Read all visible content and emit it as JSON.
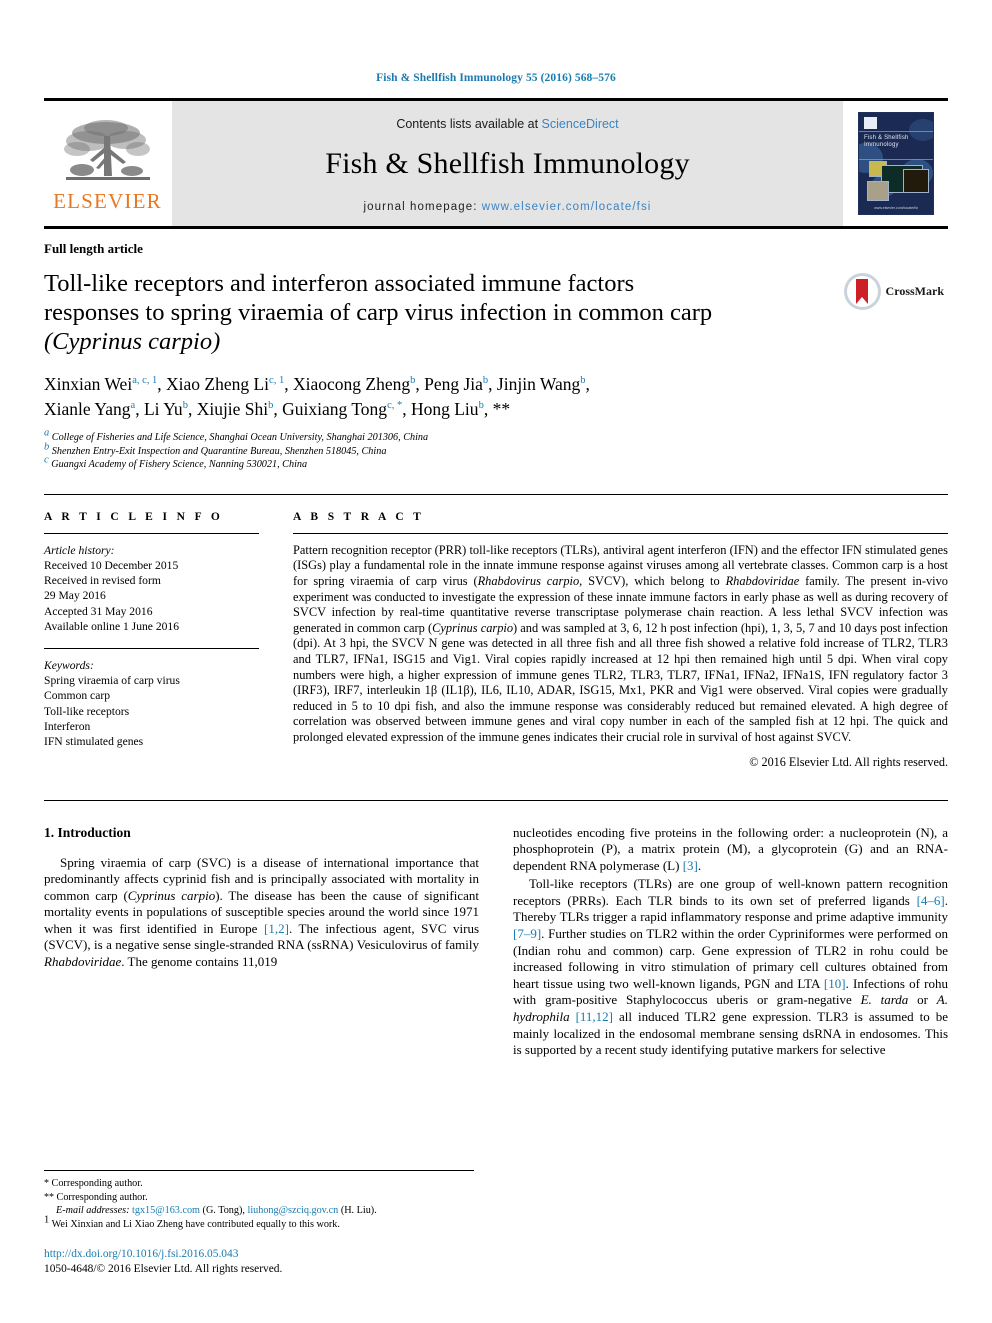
{
  "running_head": "Fish & Shellfish Immunology 55 (2016) 568–576",
  "masthead": {
    "publisher_name": "ELSEVIER",
    "publisher_logo_icon": "elsevier-tree-icon",
    "contents_prefix": "Contents lists available at ",
    "contents_link": "ScienceDirect",
    "journal_title": "Fish & Shellfish Immunology",
    "homepage_prefix": "journal homepage: ",
    "homepage_url": "www.elsevier.com/locate/fsi",
    "cover": {
      "line1": "Fish & Shellfish",
      "line2": "Immunology",
      "footer": "www.elsevier.com/locate/fsi"
    }
  },
  "article": {
    "type": "Full length article",
    "title_line1": "Toll-like receptors and interferon associated immune factors",
    "title_line2": "responses to spring viraemia of carp virus infection in common carp",
    "title_line3_italic": "(Cyprinus carpio)",
    "crossmark_label": "CrossMark",
    "authors_line1": "Xinxian Wei a, c, 1, Xiao Zheng Li c, 1, Xiaocong Zheng b, Peng Jia b, Jinjin Wang b,",
    "authors_line2": "Xianle Yang a, Li Yu b, Xiujie Shi b, Guixiang Tong c, *, Hong Liu b, **",
    "authors": [
      {
        "name": "Xinxian Wei",
        "marks": "a, c, 1"
      },
      {
        "name": "Xiao Zheng Li",
        "marks": "c, 1"
      },
      {
        "name": "Xiaocong Zheng",
        "marks": "b"
      },
      {
        "name": "Peng Jia",
        "marks": "b"
      },
      {
        "name": "Jinjin Wang",
        "marks": "b"
      },
      {
        "name": "Xianle Yang",
        "marks": "a"
      },
      {
        "name": "Li Yu",
        "marks": "b"
      },
      {
        "name": "Xiujie Shi",
        "marks": "b"
      },
      {
        "name": "Guixiang Tong",
        "marks": "c, *"
      },
      {
        "name": "Hong Liu",
        "marks": "b, **"
      }
    ],
    "affiliations": [
      {
        "mark": "a",
        "text": "College of Fisheries and Life Science, Shanghai Ocean University, Shanghai 201306, China"
      },
      {
        "mark": "b",
        "text": "Shenzhen Entry-Exit Inspection and Quarantine Bureau, Shenzhen 518045, China"
      },
      {
        "mark": "c",
        "text": "Guangxi Academy of Fishery Science, Nanning 530021, China"
      }
    ]
  },
  "article_info": {
    "heading": "A R T I C L E   I N F O",
    "history_label": "Article history:",
    "history": [
      "Received 10 December 2015",
      "Received in revised form",
      "29 May 2016",
      "Accepted 31 May 2016",
      "Available online 1 June 2016"
    ],
    "keywords_label": "Keywords:",
    "keywords": [
      "Spring viraemia of carp virus",
      "Common carp",
      "Toll-like receptors",
      "Interferon",
      "IFN stimulated genes"
    ]
  },
  "abstract": {
    "heading": "A B S T R A C T",
    "text_parts": [
      {
        "t": "Pattern recognition receptor (PRR) toll-like receptors (TLRs), antiviral agent interferon (IFN) and the effector IFN stimulated genes (ISGs) play a fundamental role in the innate immune response against viruses among all vertebrate classes. Common carp is a host for spring viraemia of carp virus (",
        "i": false
      },
      {
        "t": "Rhabdovirus carpio",
        "i": true
      },
      {
        "t": ", SVCV), which belong to ",
        "i": false
      },
      {
        "t": "Rhabdoviridae",
        "i": true
      },
      {
        "t": " family. The present in-vivo experiment was conducted to investigate the expression of these innate immune factors in early phase as well as during recovery of SVCV infection by real-time quantitative reverse transcriptase polymerase chain reaction. A less lethal SVCV infection was generated in common carp (",
        "i": false
      },
      {
        "t": "Cyprinus carpio",
        "i": true
      },
      {
        "t": ") and was sampled at 3, 6, 12 h post infection (hpi), 1, 3, 5, 7 and 10 days post infection (dpi). At 3 hpi, the SVCV N gene was detected in all three fish and all three fish showed a relative fold increase of TLR2, TLR3 and TLR7, IFNa1, ISG15 and Vig1. Viral copies rapidly increased at 12 hpi then remained high until 5 dpi. When viral copy numbers were high, a higher expression of immune genes TLR2, TLR3, TLR7, IFNa1, IFNa2, IFNa1S, IFN regulatory factor 3 (IRF3), IRF7, interleukin 1β (IL1β), IL6, IL10, ADAR, ISG15, Mx1, PKR and Vig1 were observed. Viral copies were gradually reduced in 5 to 10 dpi fish, and also the immune response was considerably reduced but remained elevated. A high degree of correlation was observed between immune genes and viral copy number in each of the sampled fish at 12 hpi. The quick and prolonged elevated expression of the immune genes indicates their crucial role in survival of host against SVCV.",
        "i": false
      }
    ],
    "copyright": "© 2016 Elsevier Ltd. All rights reserved."
  },
  "body": {
    "section_number_title": "1. Introduction",
    "left_paragraph": "Spring viraemia of carp (SVC) is a disease of international importance that predominantly affects cyprinid fish and is principally associated with mortality in common carp (Cyprinus carpio). The disease has been the cause of significant mortality events in populations of susceptible species around the world since 1971 when it was first identified in Europe [1,2]. The infectious agent, SVC virus (SVCV), is a negative sense single-stranded RNA (ssRNA) Vesiculovirus of family Rhabdoviridae. The genome contains 11,019",
    "right_paragraph_1": "nucleotides encoding five proteins in the following order: a nucleoprotein (N), a phosphoprotein (P), a matrix protein (M), a glycoprotein (G) and an RNA-dependent RNA polymerase (L) [3].",
    "right_paragraph_2": "Toll-like receptors (TLRs) are one group of well-known pattern recognition receptors (PRRs). Each TLR binds to its own set of preferred ligands [4–6]. Thereby TLRs trigger a rapid inflammatory response and prime adaptive immunity [7–9]. Further studies on TLR2 within the order Cypriniformes were performed on (Indian rohu and common) carp. Gene expression of TLR2 in rohu could be increased following in vitro stimulation of primary cell cultures obtained from heart tissue using two well-known ligands, PGN and LTA [10]. Infections of rohu with gram-positive Staphylococcus uberis or gram-negative E. tarda or A. hydrophila [11,12] all induced TLR2 gene expression. TLR3 is assumed to be mainly localized in the endosomal membrane sensing dsRNA in endosomes. This is supported by a recent study identifying putative markers for selective"
  },
  "footnotes": {
    "corresponding_1": "Corresponding author.",
    "corresponding_2": "Corresponding author.",
    "email_label": "E-mail addresses:",
    "email_1": "tgx15@163.com",
    "email_1_owner": "(G. Tong),",
    "email_2": "liuhong@szciq.gov.cn",
    "email_2_owner": "(H. Liu).",
    "equal_contribution": "Wei Xinxian and Li Xiao Zheng have contributed equally to this work.",
    "doi": "http://dx.doi.org/10.1016/j.fsi.2016.05.043",
    "issn_line": "1050-4648/© 2016 Elsevier Ltd. All rights reserved."
  },
  "colors": {
    "link_blue": "#1a7bb0",
    "sciencedirect_blue": "#3a83c4",
    "elsevier_orange": "#e87722",
    "band_gray": "#e4e4e4"
  }
}
